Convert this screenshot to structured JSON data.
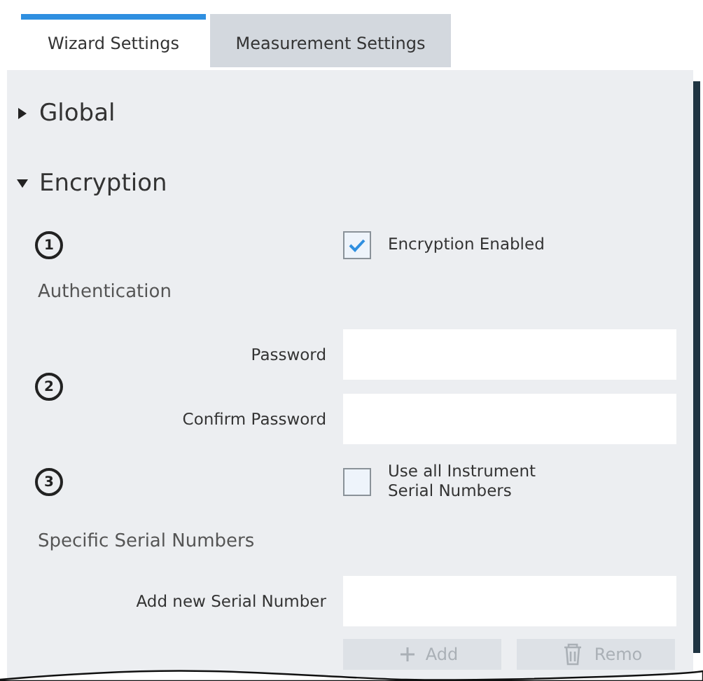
{
  "tabs": [
    {
      "label": "Wizard Settings",
      "selected": true
    },
    {
      "label": "Measurement Settings",
      "selected": false
    }
  ],
  "sections": [
    {
      "title": "Global",
      "expanded": false
    },
    {
      "title": "Encryption",
      "expanded": true
    }
  ],
  "encryption": {
    "step_1": "1",
    "encryption_enabled": {
      "label": "Encryption Enabled",
      "checked": true
    },
    "authentication_heading": "Authentication",
    "step_2": "2",
    "password_label": "Password",
    "confirm_password_label": "Confirm Password",
    "step_3": "3",
    "use_all_serials": {
      "label": "Use all Instrument Serial Numbers",
      "checked": false
    },
    "specific_serials_heading": "Specific Serial Numbers",
    "add_serial_label": "Add new Serial Number",
    "buttons": [
      {
        "label": "Add",
        "kind": "add"
      },
      {
        "label": "Remo",
        "kind": "remove"
      }
    ]
  }
}
